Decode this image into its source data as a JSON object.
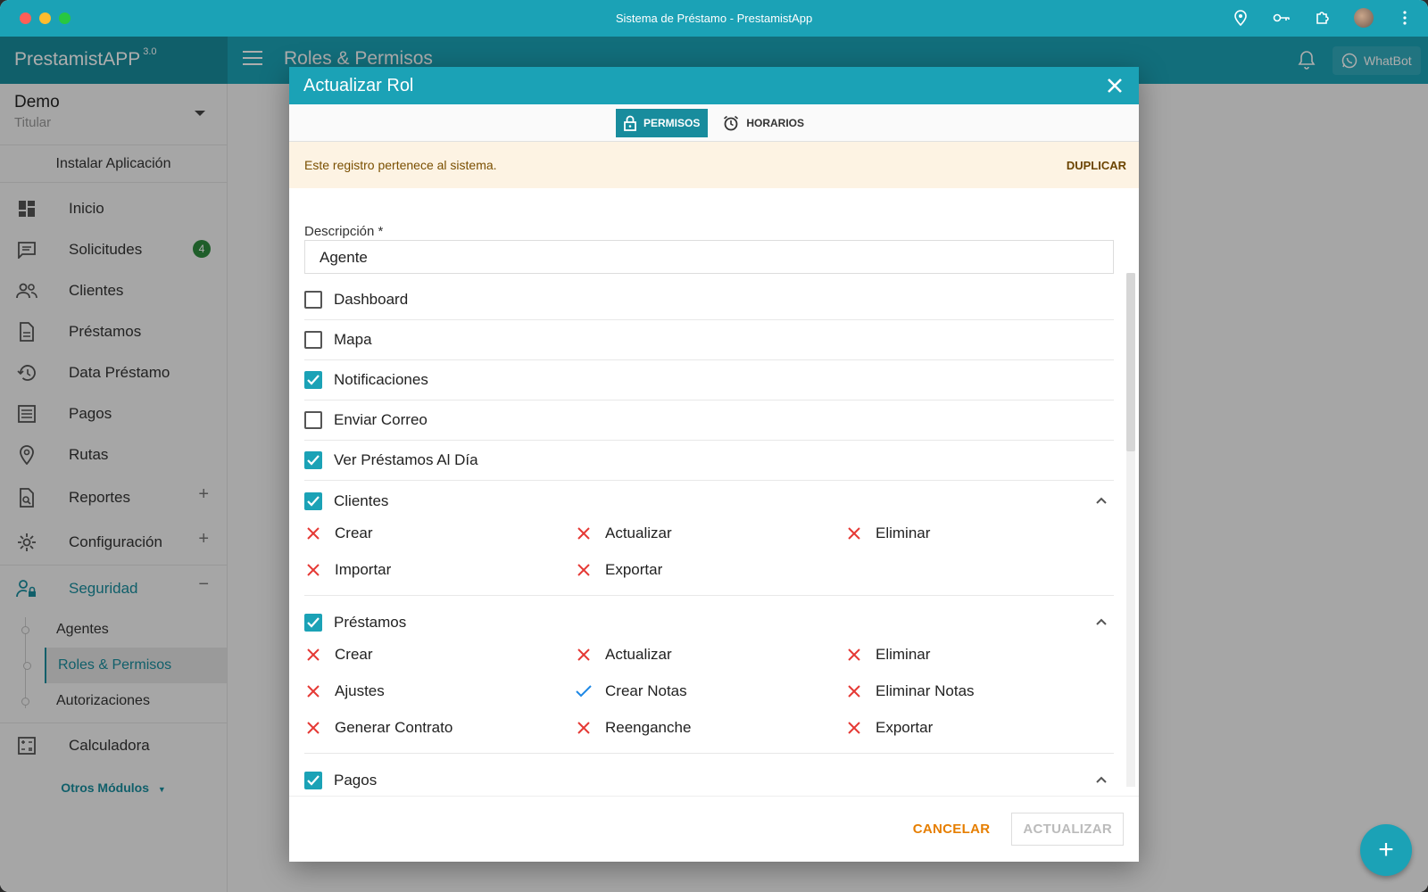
{
  "window": {
    "title": "Sistema de Préstamo - PrestamistApp"
  },
  "appbar": {
    "brand": "PrestamistAPP",
    "version": "3.0",
    "page_title": "Roles & Permisos",
    "whatbot_label": "WhatBot"
  },
  "sidebar": {
    "user": {
      "name": "Demo",
      "role": "Titular"
    },
    "install_label": "Instalar Aplicación",
    "items": [
      {
        "label": "Inicio",
        "icon": "dashboard-icon"
      },
      {
        "label": "Solicitudes",
        "icon": "chat-icon",
        "badge": "4"
      },
      {
        "label": "Clientes",
        "icon": "people-icon"
      },
      {
        "label": "Préstamos",
        "icon": "document-icon"
      },
      {
        "label": "Data Préstamo",
        "icon": "history-icon"
      },
      {
        "label": "Pagos",
        "icon": "list-icon"
      },
      {
        "label": "Rutas",
        "icon": "location-icon"
      },
      {
        "label": "Reportes",
        "icon": "report-icon",
        "expand": "+"
      },
      {
        "label": "Configuración",
        "icon": "gear-icon",
        "expand": "+"
      },
      {
        "label": "Seguridad",
        "icon": "security-icon",
        "expand": "−"
      }
    ],
    "security_sub": [
      {
        "label": "Agentes"
      },
      {
        "label": "Roles & Permisos"
      },
      {
        "label": "Autorizaciones"
      }
    ],
    "calc_label": "Calculadora",
    "otros_label": "Otros Módulos"
  },
  "dialog": {
    "title": "Actualizar Rol",
    "tabs": {
      "permisos": "PERMISOS",
      "horarios": "HORARIOS"
    },
    "notice": {
      "text": "Este registro pertenece al sistema.",
      "action": "DUPLICAR"
    },
    "description_label": "Descripción *",
    "description_value": "Agente",
    "simple_perms": [
      {
        "label": "Dashboard",
        "checked": false
      },
      {
        "label": "Mapa",
        "checked": false
      },
      {
        "label": "Notificaciones",
        "checked": true
      },
      {
        "label": "Enviar Correo",
        "checked": false
      },
      {
        "label": "Ver Préstamos Al Día",
        "checked": true
      }
    ],
    "groups": [
      {
        "label": "Clientes",
        "checked": true,
        "perms": [
          {
            "label": "Crear",
            "allowed": false
          },
          {
            "label": "Actualizar",
            "allowed": false
          },
          {
            "label": "Eliminar",
            "allowed": false
          },
          {
            "label": "Importar",
            "allowed": false
          },
          {
            "label": "Exportar",
            "allowed": false
          }
        ]
      },
      {
        "label": "Préstamos",
        "checked": true,
        "perms": [
          {
            "label": "Crear",
            "allowed": false
          },
          {
            "label": "Actualizar",
            "allowed": false
          },
          {
            "label": "Eliminar",
            "allowed": false
          },
          {
            "label": "Ajustes",
            "allowed": false
          },
          {
            "label": "Crear Notas",
            "allowed": true
          },
          {
            "label": "Eliminar Notas",
            "allowed": false
          },
          {
            "label": "Generar Contrato",
            "allowed": false
          },
          {
            "label": "Reenganche",
            "allowed": false
          },
          {
            "label": "Exportar",
            "allowed": false
          }
        ]
      },
      {
        "label": "Pagos",
        "checked": true,
        "perms": []
      }
    ],
    "buttons": {
      "cancel": "CANCELAR",
      "update": "ACTUALIZAR"
    }
  },
  "colors": {
    "accent": "#1ba2b6",
    "accent_dark": "#188c9d",
    "deny": "#e53935",
    "allow": "#1e88e5",
    "cancel": "#e67e00"
  }
}
